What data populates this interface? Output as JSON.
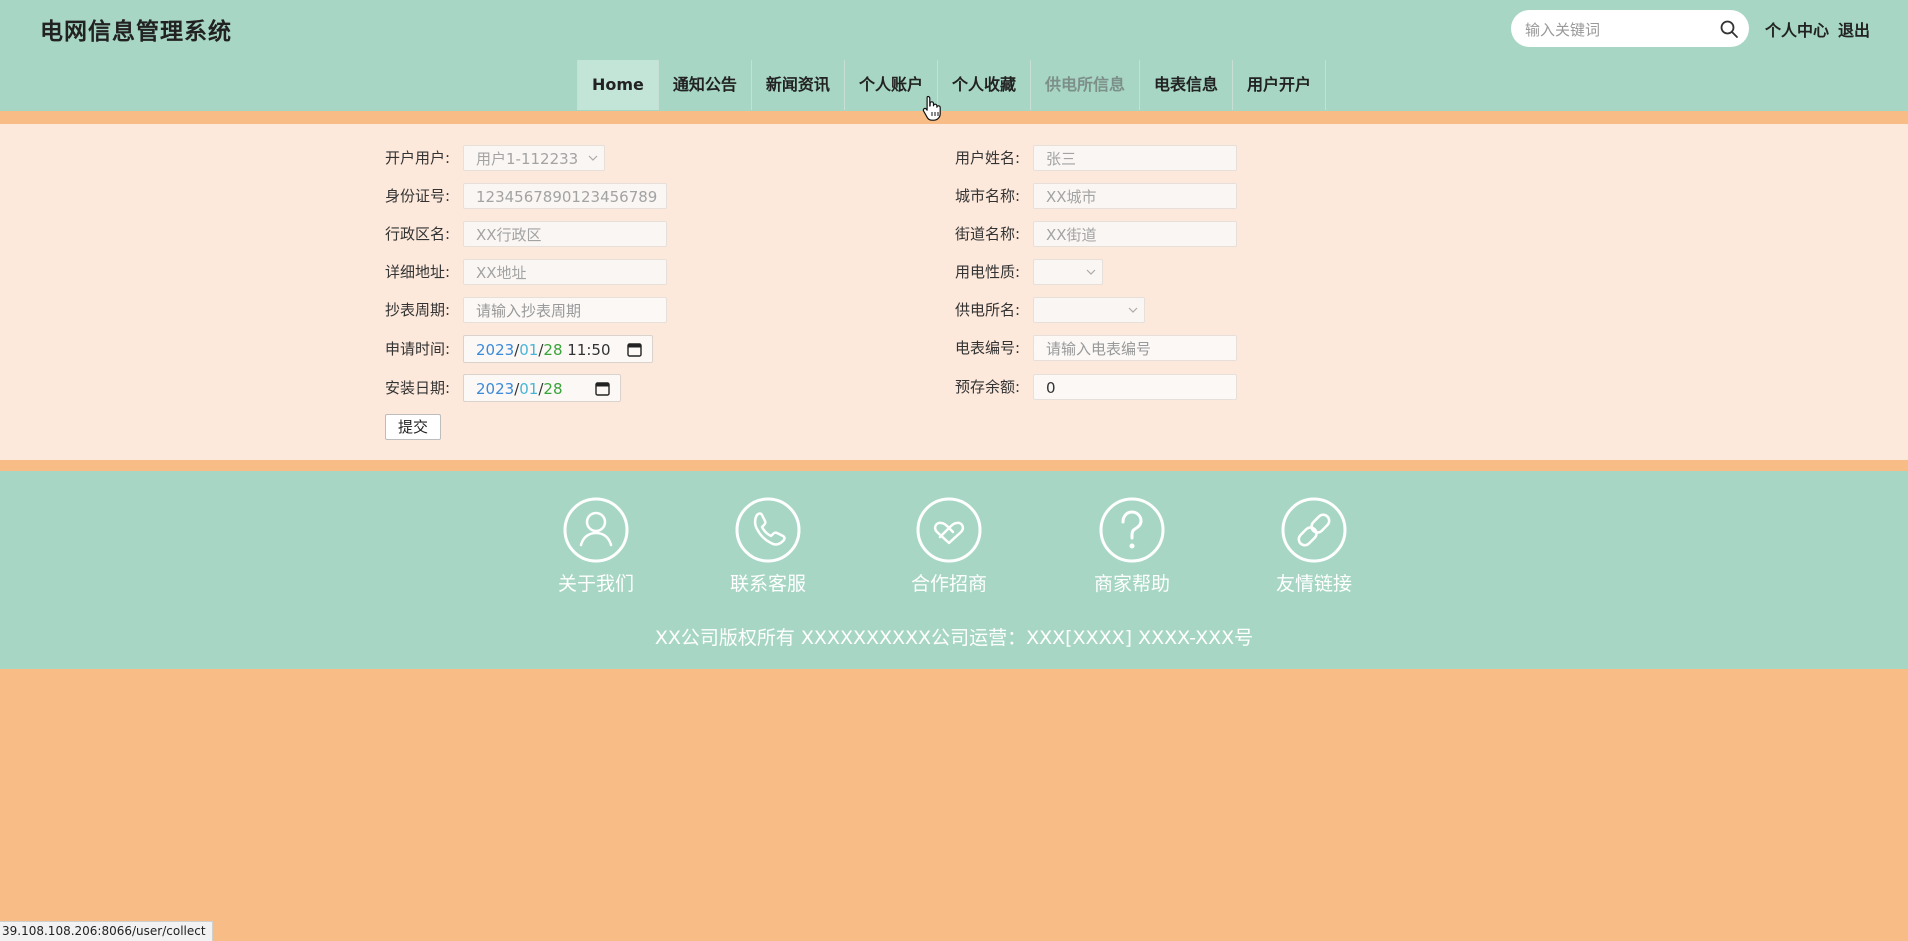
{
  "header": {
    "title": "电网信息管理系统",
    "search_placeholder": "输入关键词",
    "user_center": "个人中心",
    "logout": "退出"
  },
  "nav": {
    "items": [
      "Home",
      "通知公告",
      "新闻资讯",
      "个人账户",
      "个人收藏",
      "供电所信息",
      "电表信息",
      "用户开户"
    ],
    "active_index": 5
  },
  "form": {
    "open_user_label": "开户用户:",
    "open_user_value": "用户1-112233",
    "user_name_label": "用户姓名:",
    "user_name_value": "张三",
    "id_number_label": "身份证号:",
    "id_number_value": "1234567890123456789",
    "city_label": "城市名称:",
    "city_value": "XX城市",
    "district_label": "行政区名:",
    "district_value": "XX行政区",
    "street_label": "街道名称:",
    "street_value": "XX街道",
    "address_label": "详细地址:",
    "address_value": "XX地址",
    "usage_type_label": "用电性质:",
    "usage_type_value": "",
    "reading_cycle_label": "抄表周期:",
    "reading_cycle_placeholder": "请输入抄表周期",
    "station_name_label": "供电所名:",
    "station_name_value": "",
    "apply_time_label": "申请时间:",
    "apply_time": {
      "year": "2023",
      "month": "01",
      "day": "28",
      "time": "11:50"
    },
    "meter_no_label": "电表编号:",
    "meter_no_placeholder": "请输入电表编号",
    "install_date_label": "安装日期:",
    "install_date": {
      "year": "2023",
      "month": "01",
      "day": "28"
    },
    "balance_label": "预存余额:",
    "balance_value": "0",
    "submit_label": "提交"
  },
  "footer": {
    "items": [
      {
        "label": "关于我们",
        "icon": "user-icon"
      },
      {
        "label": "联系客服",
        "icon": "phone-icon"
      },
      {
        "label": "合作招商",
        "icon": "handshake-icon"
      },
      {
        "label": "商家帮助",
        "icon": "help-icon"
      },
      {
        "label": "友情链接",
        "icon": "link-icon"
      }
    ],
    "copyright": "XX公司版权所有 XXXXXXXXXX公司运营：XXX[XXXX] XXXX-XXX号"
  },
  "status_bar": {
    "url": "39.108.108.206:8066/user/collect"
  },
  "colors": {
    "green": "#a7d7c4",
    "orange": "#f8bd87",
    "panel": "#fde9dc"
  }
}
